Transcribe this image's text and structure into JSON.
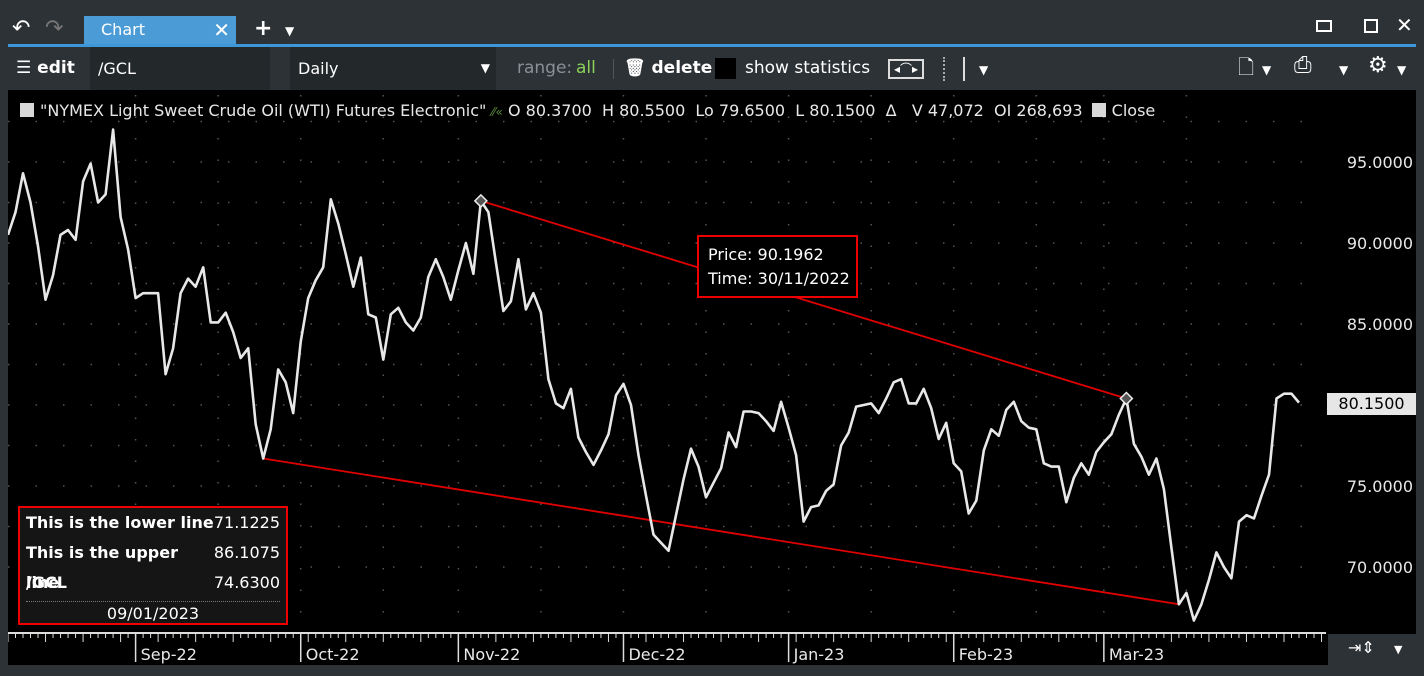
{
  "window": {
    "tab_label": "Chart",
    "icons": [
      "undo-icon",
      "redo-icon",
      "close-tab-icon",
      "add-tab-icon",
      "caret-down-icon",
      "restore-icon",
      "maximize-icon",
      "close-window-icon"
    ]
  },
  "toolbar": {
    "edit_label": "edit",
    "symbol_value": "/GCL",
    "interval_value": "Daily",
    "range_label": "range:",
    "range_value": "all",
    "delete_label": "delete",
    "show_statistics_label": "show statistics",
    "show_statistics_checked": false,
    "colors": {
      "range_value": "#8cd05a",
      "range_label": "#8a9096"
    }
  },
  "legend": {
    "instrument": "\"NYMEX Light Sweet Crude Oil (WTI) Futures Electronic\"",
    "open": "O 80.3700",
    "high": "H 80.5500",
    "low": "Lo 79.6500",
    "last": "L 80.1500",
    "delta": "Δ",
    "volume": "V 47,072",
    "open_interest": "OI 268,693",
    "series": "Close"
  },
  "tooltip": {
    "price": "Price: 90.1962",
    "time": "Time: 30/11/2022"
  },
  "stats_box": {
    "rows": [
      {
        "label": "This is the lower line",
        "value": "71.1225"
      },
      {
        "label": "This is the upper line",
        "value": "86.1075"
      },
      {
        "label": "/GCL",
        "value": "74.6300"
      }
    ],
    "date": "09/01/2023"
  },
  "current_price_label": "80.1500",
  "chart_data": {
    "type": "line",
    "ylim": [
      66,
      98.5
    ],
    "y_ticks": [
      "95.0000",
      "90.0000",
      "85.0000",
      "80.0000",
      "75.0000",
      "70.0000"
    ],
    "y_tick_values": [
      95,
      90,
      85,
      80,
      75,
      70
    ],
    "grid": true,
    "line_color": "#e8e8e8",
    "trend_color": "#e00000",
    "x_labels": [
      {
        "label": "Sep-22",
        "index": 17
      },
      {
        "label": "Oct-22",
        "index": 39
      },
      {
        "label": "Nov-22",
        "index": 60
      },
      {
        "label": "Dec-22",
        "index": 82
      },
      {
        "label": "Jan-23",
        "index": 104
      },
      {
        "label": "Feb-23",
        "index": 126
      },
      {
        "label": "Mar-23",
        "index": 146
      }
    ],
    "close": [
      90.5,
      91.9,
      94.3,
      92.5,
      89.8,
      86.5,
      88.0,
      90.5,
      90.8,
      90.2,
      93.8,
      94.9,
      92.5,
      93.0,
      97.0,
      91.6,
      89.6,
      86.6,
      86.9,
      86.9,
      86.9,
      81.9,
      83.5,
      86.9,
      87.8,
      87.3,
      88.5,
      85.1,
      85.1,
      85.7,
      84.5,
      82.9,
      83.5,
      78.8,
      76.7,
      78.5,
      82.2,
      81.4,
      79.5,
      83.9,
      86.6,
      87.7,
      88.5,
      92.7,
      91.2,
      89.3,
      87.3,
      89.1,
      85.6,
      85.4,
      82.8,
      85.6,
      86.0,
      85.1,
      84.6,
      85.4,
      87.9,
      89.0,
      87.9,
      86.5,
      88.3,
      90.0,
      88.1,
      92.6,
      91.9,
      88.8,
      85.8,
      86.4,
      89.0,
      85.9,
      86.9,
      85.7,
      81.6,
      80.1,
      79.8,
      81.0,
      78.0,
      77.1,
      76.3,
      77.2,
      78.2,
      80.6,
      81.3,
      80.0,
      76.9,
      74.4,
      72.0,
      71.5,
      71.0,
      73.2,
      75.4,
      77.3,
      76.2,
      74.3,
      75.2,
      76.1,
      78.3,
      77.4,
      79.6,
      79.6,
      79.5,
      79.0,
      78.4,
      80.2,
      78.6,
      76.9,
      72.8,
      73.7,
      73.8,
      74.7,
      75.1,
      77.5,
      78.3,
      79.9,
      80.0,
      80.1,
      79.5,
      80.4,
      81.4,
      81.6,
      80.1,
      80.1,
      81.0,
      79.8,
      77.9,
      78.9,
      76.4,
      75.9,
      73.3,
      74.1,
      77.2,
      78.5,
      78.1,
      79.7,
      80.2,
      79.0,
      78.6,
      78.5,
      76.4,
      76.2,
      76.2,
      74.0,
      75.5,
      76.4,
      75.7,
      77.1,
      77.7,
      78.2,
      79.4,
      80.4,
      77.6,
      76.8,
      75.7,
      76.7,
      74.8,
      71.2,
      67.7,
      68.4,
      66.7,
      67.7,
      69.2,
      70.9,
      70.0,
      69.3,
      72.8,
      73.2,
      73.0,
      74.4,
      75.7,
      80.4,
      80.7,
      80.7,
      80.15
    ],
    "trend_lines": [
      {
        "name": "upper",
        "start_index": 63,
        "start_price": 92.6,
        "end_index": 149,
        "end_price": 80.4,
        "endpoint_markers": true
      },
      {
        "name": "lower",
        "start_index": 34,
        "start_price": 76.7,
        "end_index": 156,
        "end_price": 67.7,
        "endpoint_markers": false
      }
    ]
  }
}
